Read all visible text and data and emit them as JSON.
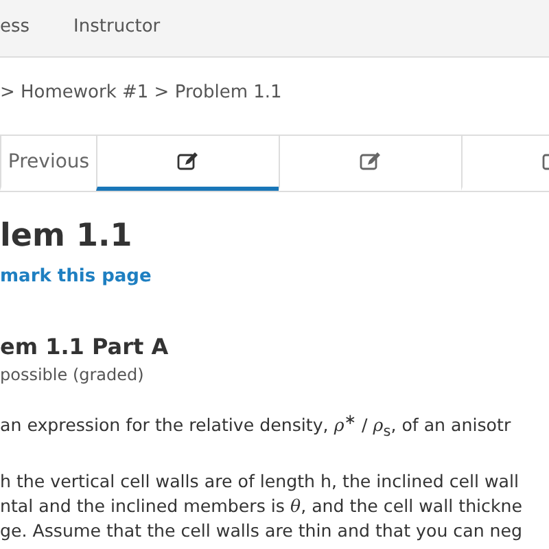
{
  "nav": {
    "items": [
      {
        "label": "ess"
      },
      {
        "label": "Instructor"
      }
    ]
  },
  "breadcrumb": "> Homework #1 > Problem 1.1",
  "sequence_tabs": [
    {
      "kind": "text",
      "label": "Previous",
      "selected": false
    },
    {
      "kind": "icon",
      "selected": true
    },
    {
      "kind": "icon",
      "selected": false
    },
    {
      "kind": "icon",
      "selected": false
    }
  ],
  "title": "lem 1.1",
  "bookmark": "mark this page",
  "part": {
    "title": "em 1.1 Part A",
    "points": "possible (graded)"
  },
  "paragraphs": [
    "an expression for the relative density, *ρ*$^{∗}$ / *ρ*$_{s}$, of an anisotr",
    "h the vertical cell walls are of length h, the inclined cell wall",
    "ntal and the inclined members is *θ*, and the cell wall thickne",
    "ge. Assume that the cell walls are thin and that you can neg"
  ]
}
